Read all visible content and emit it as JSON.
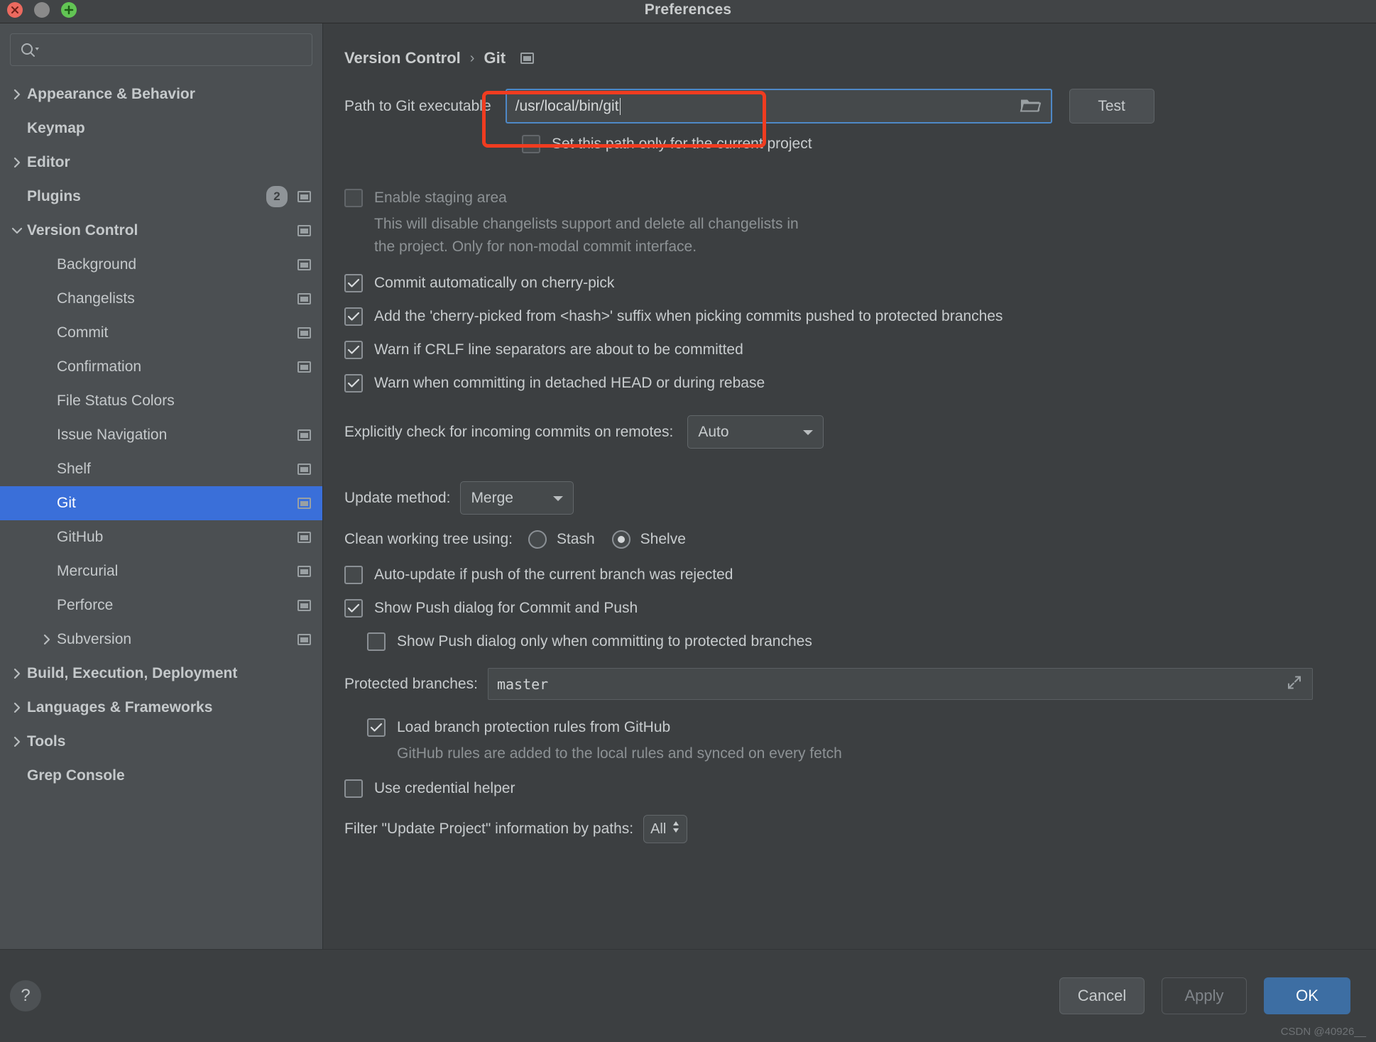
{
  "window": {
    "title": "Preferences",
    "traffic_lights": [
      "close",
      "minimize",
      "zoom"
    ]
  },
  "sidebar": {
    "search": {
      "placeholder": ""
    },
    "items": [
      {
        "label": "Appearance & Behavior",
        "level": 1,
        "bold": true,
        "arrow": "collapsed",
        "badge": null,
        "copy_icon": false,
        "selected": false
      },
      {
        "label": "Keymap",
        "level": 1,
        "bold": true,
        "arrow": "none",
        "badge": null,
        "copy_icon": false,
        "selected": false
      },
      {
        "label": "Editor",
        "level": 1,
        "bold": true,
        "arrow": "collapsed",
        "badge": null,
        "copy_icon": false,
        "selected": false
      },
      {
        "label": "Plugins",
        "level": 1,
        "bold": true,
        "arrow": "none",
        "badge": "2",
        "copy_icon": true,
        "selected": false
      },
      {
        "label": "Version Control",
        "level": 1,
        "bold": true,
        "arrow": "expanded",
        "badge": null,
        "copy_icon": true,
        "selected": false
      },
      {
        "label": "Background",
        "level": 2,
        "bold": false,
        "arrow": "none",
        "badge": null,
        "copy_icon": true,
        "selected": false
      },
      {
        "label": "Changelists",
        "level": 2,
        "bold": false,
        "arrow": "none",
        "badge": null,
        "copy_icon": true,
        "selected": false
      },
      {
        "label": "Commit",
        "level": 2,
        "bold": false,
        "arrow": "none",
        "badge": null,
        "copy_icon": true,
        "selected": false
      },
      {
        "label": "Confirmation",
        "level": 2,
        "bold": false,
        "arrow": "none",
        "badge": null,
        "copy_icon": true,
        "selected": false
      },
      {
        "label": "File Status Colors",
        "level": 2,
        "bold": false,
        "arrow": "none",
        "badge": null,
        "copy_icon": false,
        "selected": false
      },
      {
        "label": "Issue Navigation",
        "level": 2,
        "bold": false,
        "arrow": "none",
        "badge": null,
        "copy_icon": true,
        "selected": false
      },
      {
        "label": "Shelf",
        "level": 2,
        "bold": false,
        "arrow": "none",
        "badge": null,
        "copy_icon": true,
        "selected": false
      },
      {
        "label": "Git",
        "level": 2,
        "bold": false,
        "arrow": "none",
        "badge": null,
        "copy_icon": true,
        "selected": true
      },
      {
        "label": "GitHub",
        "level": 2,
        "bold": false,
        "arrow": "none",
        "badge": null,
        "copy_icon": true,
        "selected": false
      },
      {
        "label": "Mercurial",
        "level": 2,
        "bold": false,
        "arrow": "none",
        "badge": null,
        "copy_icon": true,
        "selected": false
      },
      {
        "label": "Perforce",
        "level": 2,
        "bold": false,
        "arrow": "none",
        "badge": null,
        "copy_icon": true,
        "selected": false
      },
      {
        "label": "Subversion",
        "level": 2,
        "bold": false,
        "arrow": "collapsed",
        "badge": null,
        "copy_icon": true,
        "selected": false
      },
      {
        "label": "Build, Execution, Deployment",
        "level": 1,
        "bold": true,
        "arrow": "collapsed",
        "badge": null,
        "copy_icon": false,
        "selected": false
      },
      {
        "label": "Languages & Frameworks",
        "level": 1,
        "bold": true,
        "arrow": "collapsed",
        "badge": null,
        "copy_icon": false,
        "selected": false
      },
      {
        "label": "Tools",
        "level": 1,
        "bold": true,
        "arrow": "collapsed",
        "badge": null,
        "copy_icon": false,
        "selected": false
      },
      {
        "label": "Grep Console",
        "level": 1,
        "bold": true,
        "arrow": "none",
        "badge": null,
        "copy_icon": false,
        "selected": false
      }
    ]
  },
  "breadcrumb": {
    "parent": "Version Control",
    "separator": "›",
    "current": "Git"
  },
  "main": {
    "path_row": {
      "label": "Path to Git executable",
      "value": "/usr/local/bin/git",
      "test_button": "Test",
      "highlight_color": "#f03c20",
      "focus_color": "#4e88c7"
    },
    "set_path_only": {
      "label": "Set this path only for the current project",
      "checked": false
    },
    "enable_staging": {
      "label": "Enable staging area",
      "checked": false,
      "disabled": true,
      "description_line1": "This will disable changelists support and delete all changelists in",
      "description_line2": "the project. Only for non-modal commit interface."
    },
    "checkboxes": [
      {
        "label": "Commit automatically on cherry-pick",
        "checked": true
      },
      {
        "label": "Add the 'cherry-picked from <hash>' suffix when picking commits pushed to protected branches",
        "checked": true
      },
      {
        "label": "Warn if CRLF line separators are about to be committed",
        "checked": true
      },
      {
        "label": "Warn when committing in detached HEAD or during rebase",
        "checked": true
      }
    ],
    "incoming_commits": {
      "label": "Explicitly check for incoming commits on remotes:",
      "value": "Auto"
    },
    "update_method": {
      "label": "Update method:",
      "value": "Merge"
    },
    "clean_working_tree": {
      "label": "Clean working tree using:",
      "options": [
        "Stash",
        "Shelve"
      ],
      "selected": "Shelve"
    },
    "auto_update": {
      "label": "Auto-update if push of the current branch was rejected",
      "checked": false
    },
    "show_push_dialog": {
      "label": "Show Push dialog for Commit and Push",
      "checked": true
    },
    "show_push_dialog_protected": {
      "label": "Show Push dialog only when committing to protected branches",
      "checked": false
    },
    "protected_branches": {
      "label": "Protected branches:",
      "value": "master"
    },
    "load_branch_rules": {
      "label": "Load branch protection rules from GitHub",
      "checked": true,
      "description": "GitHub rules are added to the local rules and synced on every fetch"
    },
    "credential_helper": {
      "label": "Use credential helper",
      "checked": false
    },
    "filter_paths": {
      "label": "Filter \"Update Project\" information by paths:",
      "value": "All"
    }
  },
  "footer": {
    "help": "?",
    "cancel": "Cancel",
    "apply": "Apply",
    "ok": "OK",
    "ok_color": "#3d6ea3"
  },
  "watermark": "CSDN @40926__"
}
